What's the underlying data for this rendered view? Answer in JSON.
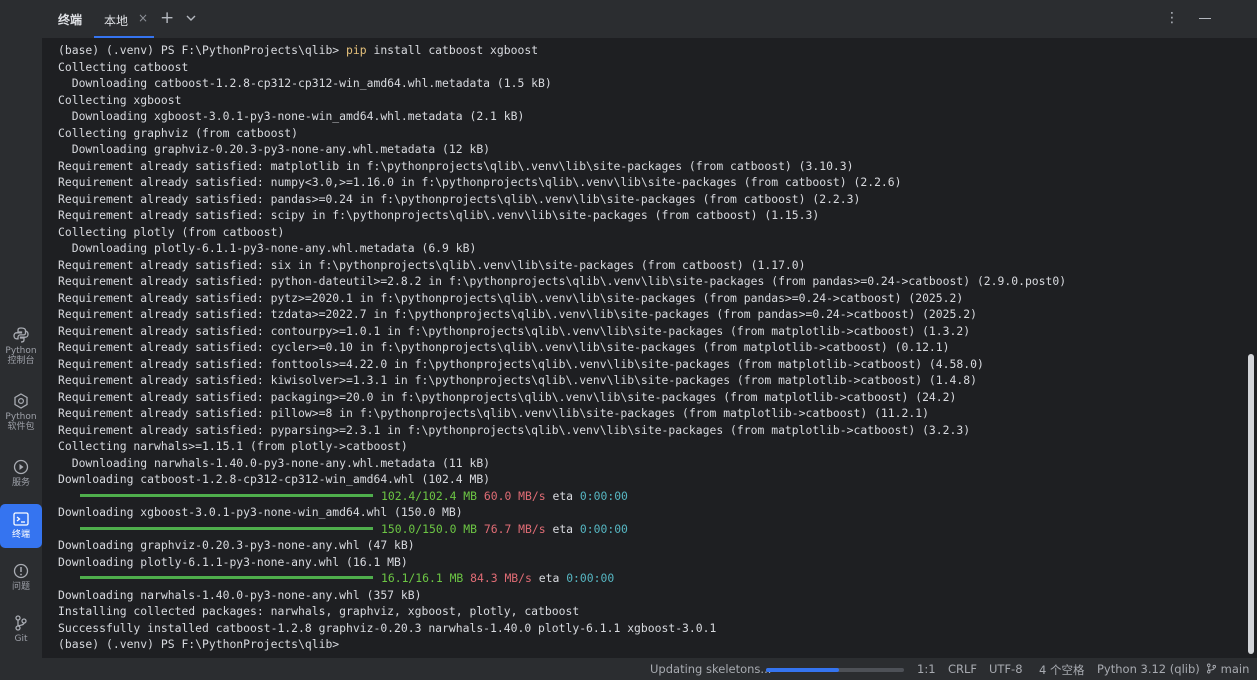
{
  "tool_window": {
    "title": "终端",
    "tabs": [
      {
        "label": "本地",
        "close": "×"
      }
    ],
    "add_label": "+",
    "more_label": "⋮"
  },
  "sidebar": {
    "items": [
      {
        "line1": "Python",
        "line2": "控制台",
        "icon": "python-console-icon"
      },
      {
        "line1": "Python",
        "line2": "软件包",
        "icon": "python-packages-icon"
      },
      {
        "line1": "服务",
        "line2": "",
        "icon": "services-icon"
      },
      {
        "line1": "终端",
        "line2": "",
        "icon": "terminal-icon",
        "active": true
      },
      {
        "line1": "问题",
        "line2": "",
        "icon": "problems-icon"
      },
      {
        "line1": "Git",
        "line2": "",
        "icon": "git-icon"
      }
    ]
  },
  "terminal": {
    "prompt_cmd": {
      "prompt": "(base) (.venv) PS F:\\PythonProjects\\qlib> ",
      "cmd": "pip",
      "args": " install catboost xgboost"
    },
    "lines": [
      "Collecting catboost",
      "  Downloading catboost-1.2.8-cp312-cp312-win_amd64.whl.metadata (1.5 kB)",
      "Collecting xgboost",
      "  Downloading xgboost-3.0.1-py3-none-win_amd64.whl.metadata (2.1 kB)",
      "Collecting graphviz (from catboost)",
      "  Downloading graphviz-0.20.3-py3-none-any.whl.metadata (12 kB)",
      "Requirement already satisfied: matplotlib in f:\\pythonprojects\\qlib\\.venv\\lib\\site-packages (from catboost) (3.10.3)",
      "Requirement already satisfied: numpy<3.0,>=1.16.0 in f:\\pythonprojects\\qlib\\.venv\\lib\\site-packages (from catboost) (2.2.6)",
      "Requirement already satisfied: pandas>=0.24 in f:\\pythonprojects\\qlib\\.venv\\lib\\site-packages (from catboost) (2.2.3)",
      "Requirement already satisfied: scipy in f:\\pythonprojects\\qlib\\.venv\\lib\\site-packages (from catboost) (1.15.3)",
      "Collecting plotly (from catboost)",
      "  Downloading plotly-6.1.1-py3-none-any.whl.metadata (6.9 kB)",
      "Requirement already satisfied: six in f:\\pythonprojects\\qlib\\.venv\\lib\\site-packages (from catboost) (1.17.0)",
      "Requirement already satisfied: python-dateutil>=2.8.2 in f:\\pythonprojects\\qlib\\.venv\\lib\\site-packages (from pandas>=0.24->catboost) (2.9.0.post0)",
      "Requirement already satisfied: pytz>=2020.1 in f:\\pythonprojects\\qlib\\.venv\\lib\\site-packages (from pandas>=0.24->catboost) (2025.2)",
      "Requirement already satisfied: tzdata>=2022.7 in f:\\pythonprojects\\qlib\\.venv\\lib\\site-packages (from pandas>=0.24->catboost) (2025.2)",
      "Requirement already satisfied: contourpy>=1.0.1 in f:\\pythonprojects\\qlib\\.venv\\lib\\site-packages (from matplotlib->catboost) (1.3.2)",
      "Requirement already satisfied: cycler>=0.10 in f:\\pythonprojects\\qlib\\.venv\\lib\\site-packages (from matplotlib->catboost) (0.12.1)",
      "Requirement already satisfied: fonttools>=4.22.0 in f:\\pythonprojects\\qlib\\.venv\\lib\\site-packages (from matplotlib->catboost) (4.58.0)",
      "Requirement already satisfied: kiwisolver>=1.3.1 in f:\\pythonprojects\\qlib\\.venv\\lib\\site-packages (from matplotlib->catboost) (1.4.8)",
      "Requirement already satisfied: packaging>=20.0 in f:\\pythonprojects\\qlib\\.venv\\lib\\site-packages (from matplotlib->catboost) (24.2)",
      "Requirement already satisfied: pillow>=8 in f:\\pythonprojects\\qlib\\.venv\\lib\\site-packages (from matplotlib->catboost) (11.2.1)",
      "Requirement already satisfied: pyparsing>=2.3.1 in f:\\pythonprojects\\qlib\\.venv\\lib\\site-packages (from matplotlib->catboost) (3.2.3)",
      "Collecting narwhals>=1.15.1 (from plotly->catboost)",
      "  Downloading narwhals-1.40.0-py3-none-any.whl.metadata (11 kB)",
      "Downloading catboost-1.2.8-cp312-cp312-win_amd64.whl (102.4 MB)"
    ],
    "progress_1": {
      "size": "102.4/102.4 MB",
      "speed": "60.0 MB/s",
      "eta_label": "eta",
      "eta": "0:00:00"
    },
    "line_after_1": "Downloading xgboost-3.0.1-py3-none-win_amd64.whl (150.0 MB)",
    "progress_2": {
      "size": "150.0/150.0 MB",
      "speed": "76.7 MB/s",
      "eta_label": "eta",
      "eta": "0:00:00"
    },
    "lines_after_2": [
      "Downloading graphviz-0.20.3-py3-none-any.whl (47 kB)",
      "Downloading plotly-6.1.1-py3-none-any.whl (16.1 MB)"
    ],
    "progress_3": {
      "size": "16.1/16.1 MB",
      "speed": "84.3 MB/s",
      "eta_label": "eta",
      "eta": "0:00:00"
    },
    "lines_after_3": [
      "Downloading narwhals-1.40.0-py3-none-any.whl (357 kB)",
      "Installing collected packages: narwhals, graphviz, xgboost, plotly, catboost",
      "Successfully installed catboost-1.2.8 graphviz-0.20.3 narwhals-1.40.0 plotly-6.1.1 xgboost-3.0.1",
      "(base) (.venv) PS F:\\PythonProjects\\qlib>"
    ]
  },
  "statusbar": {
    "task": "Updating skeletons...",
    "task_progress": 0.53,
    "position": "1:1",
    "line_sep": "CRLF",
    "encoding": "UTF-8",
    "indent": "4 个空格",
    "interpreter": "Python 3.12 (qlib)",
    "branch": "main"
  },
  "colors": {
    "accent": "#3574f0",
    "progress_green": "#4fae4c",
    "speed_red": "#e06c75",
    "eta_cyan": "#56b6c2"
  }
}
